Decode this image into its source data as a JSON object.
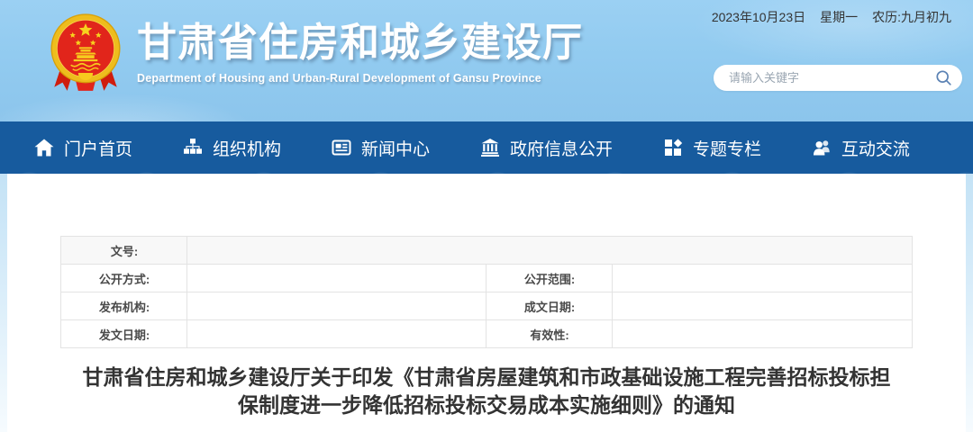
{
  "header": {
    "date": "2023年10月23日",
    "weekday": "星期一",
    "lunar": "农历:九月初九",
    "site_title": "甘肃省住房和城乡建设厅",
    "site_subtitle": "Department of Housing and Urban-Rural Development of Gansu Province",
    "search_placeholder": "请输入关键字"
  },
  "nav": {
    "items": [
      {
        "label": "门户首页",
        "icon": "home-icon"
      },
      {
        "label": "组织机构",
        "icon": "org-chart-icon"
      },
      {
        "label": "新闻中心",
        "icon": "news-icon"
      },
      {
        "label": "政府信息公开",
        "icon": "gov-building-icon"
      },
      {
        "label": "专题专栏",
        "icon": "topics-grid-icon"
      },
      {
        "label": "互动交流",
        "icon": "people-icon"
      }
    ]
  },
  "doc_info": {
    "doc_number": {
      "label": "文号:",
      "value": ""
    },
    "fields": [
      {
        "label": "公开方式:",
        "value": ""
      },
      {
        "label": "公开范围:",
        "value": ""
      },
      {
        "label": "发布机构:",
        "value": ""
      },
      {
        "label": "成文日期:",
        "value": ""
      },
      {
        "label": "发文日期:",
        "value": ""
      },
      {
        "label": "有效性:",
        "value": ""
      }
    ]
  },
  "article": {
    "title_line1": "甘肃省住房和城乡建设厅关于印发《甘肃省房屋建筑和市政基础设施工程完善招标投标担",
    "title_line2": "保制度进一步降低招标投标交易成本实施细则》的通知"
  },
  "colors": {
    "nav_blue": "#175b9e",
    "sky_blue": "#92cbf0",
    "emblem_red": "#e1251b",
    "emblem_gold": "#f0c01e",
    "title_text": "#333333"
  }
}
